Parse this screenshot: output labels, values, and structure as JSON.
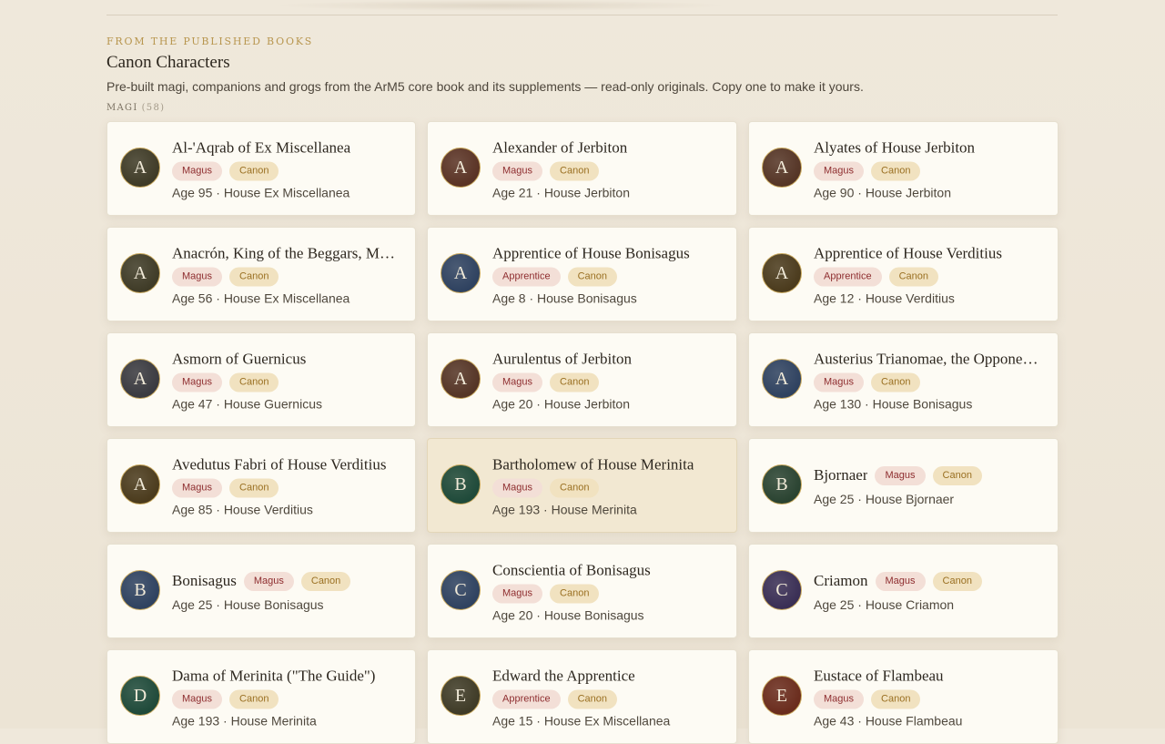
{
  "section": {
    "eyebrow": "From the published books",
    "title": "Canon Characters",
    "subtitle": "Pre-built magi, companions and grogs from the ArM5 core book and its supplements — read-only originals. Copy one to make it yours.",
    "group_label": "MAGI",
    "group_count": "(58)"
  },
  "colors": {
    "accent_gold": "#b8964f",
    "role_badge_text": "#8e2d2f",
    "canon_badge_text": "#9a7022"
  },
  "cards": [
    {
      "initial": "A",
      "avatar_color": "#3f3b27",
      "name": "Al-'Aqrab of Ex Miscellanea",
      "badges": [
        "Magus",
        "Canon"
      ],
      "meta": "Age 95 · House Ex Miscellanea",
      "layout": "twoline"
    },
    {
      "initial": "A",
      "avatar_color": "#5a3325",
      "name": "Alexander of Jerbiton",
      "badges": [
        "Magus",
        "Canon"
      ],
      "meta": "Age 21 · House Jerbiton",
      "layout": "twoline"
    },
    {
      "initial": "A",
      "avatar_color": "#553526",
      "name": "Alyates of House Jerbiton",
      "badges": [
        "Magus",
        "Canon"
      ],
      "meta": "Age 90 · House Jerbiton",
      "layout": "twoline"
    },
    {
      "initial": "A",
      "avatar_color": "#3f3b27",
      "name": "Anacrón, King of the Beggars, Magus of Ex Miscellanea",
      "badges": [
        "Magus",
        "Canon"
      ],
      "meta": "Age 56 · House Ex Miscellanea",
      "layout": "twoline"
    },
    {
      "initial": "A",
      "avatar_color": "#2f4260",
      "name": "Apprentice of House Bonisagus",
      "badges": [
        "Apprentice",
        "Canon"
      ],
      "meta": "Age 8 · House Bonisagus",
      "layout": "twoline"
    },
    {
      "initial": "A",
      "avatar_color": "#4b3b1d",
      "name": "Apprentice of House Verditius",
      "badges": [
        "Apprentice",
        "Canon"
      ],
      "meta": "Age 12 · House Verditius",
      "layout": "twoline"
    },
    {
      "initial": "A",
      "avatar_color": "#3a3a40",
      "name": "Asmorn of Guernicus",
      "badges": [
        "Magus",
        "Canon"
      ],
      "meta": "Age 47 · House Guernicus",
      "layout": "twoline"
    },
    {
      "initial": "A",
      "avatar_color": "#553526",
      "name": "Aurulentus of Jerbiton",
      "badges": [
        "Magus",
        "Canon"
      ],
      "meta": "Age 20 · House Jerbiton",
      "layout": "twoline"
    },
    {
      "initial": "A",
      "avatar_color": "#2f4260",
      "name": "Austerius Trianomae, the Opponent of Bonisagus",
      "badges": [
        "Magus",
        "Canon"
      ],
      "meta": "Age 130 · House Bonisagus",
      "layout": "twoline"
    },
    {
      "initial": "A",
      "avatar_color": "#4b3b1d",
      "name": "Avedutus Fabri of House Verditius",
      "badges": [
        "Magus",
        "Canon"
      ],
      "meta": "Age 85 · House Verditius",
      "layout": "twoline"
    },
    {
      "initial": "B",
      "avatar_color": "#1f4a3a",
      "name": "Bartholomew of House Merinita",
      "badges": [
        "Magus",
        "Canon"
      ],
      "meta": "Age 193 · House Merinita",
      "layout": "twoline",
      "selected": true
    },
    {
      "initial": "B",
      "avatar_color": "#2a4331",
      "name": "Bjornaer",
      "badges": [
        "Magus",
        "Canon"
      ],
      "meta": "Age 25 · House Bjornaer",
      "layout": "oneline"
    },
    {
      "initial": "B",
      "avatar_color": "#2f4260",
      "name": "Bonisagus",
      "badges": [
        "Magus",
        "Canon"
      ],
      "meta": "Age 25 · House Bonisagus",
      "layout": "oneline"
    },
    {
      "initial": "C",
      "avatar_color": "#2f4260",
      "name": "Conscientia of Bonisagus",
      "badges": [
        "Magus",
        "Canon"
      ],
      "meta": "Age 20 · House Bonisagus",
      "layout": "twoline"
    },
    {
      "initial": "C",
      "avatar_color": "#3a2f55",
      "name": "Criamon",
      "badges": [
        "Magus",
        "Canon"
      ],
      "meta": "Age 25 · House Criamon",
      "layout": "oneline"
    },
    {
      "initial": "D",
      "avatar_color": "#1f4a3a",
      "name": "Dama of Merinita (\"The Guide\")",
      "badges": [
        "Magus",
        "Canon"
      ],
      "meta": "Age 193 · House Merinita",
      "layout": "twoline"
    },
    {
      "initial": "E",
      "avatar_color": "#3f3b27",
      "name": "Edward the Apprentice",
      "badges": [
        "Apprentice",
        "Canon"
      ],
      "meta": "Age 15 · House Ex Miscellanea",
      "layout": "twoline"
    },
    {
      "initial": "E",
      "avatar_color": "#6a2c1d",
      "name": "Eustace of Flambeau",
      "badges": [
        "Magus",
        "Canon"
      ],
      "meta": "Age 43 · House Flambeau",
      "layout": "twoline"
    }
  ]
}
